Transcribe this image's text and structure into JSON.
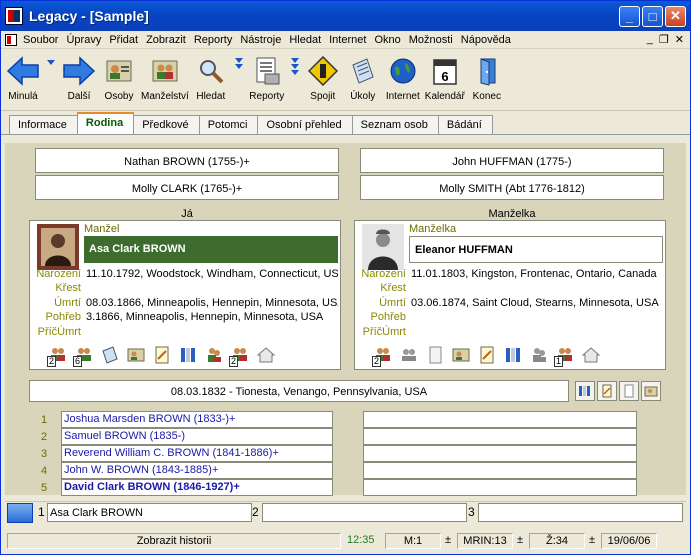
{
  "window": {
    "title": "Legacy - [Sample]",
    "min": "_",
    "max": "□",
    "close": "✕"
  },
  "menu": [
    "Soubor",
    "Úpravy",
    "Přidat",
    "Zobrazit",
    "Reporty",
    "Nástroje",
    "Hledat",
    "Internet",
    "Okno",
    "Možnosti",
    "Nápověda"
  ],
  "mdi": {
    "min": "_",
    "restore": "❐",
    "close": "✕"
  },
  "toolbar": {
    "back": "Minulá",
    "next": "Další",
    "people": "Osoby",
    "marriages": "Manželství",
    "search": "Hledat",
    "reports": "Reporty",
    "link": "Spojit",
    "tasks": "Úkoly",
    "internet": "Internet",
    "calendar": "Kalendář",
    "exit": "Konec",
    "calendar_day": "6"
  },
  "tabs": [
    "Informace",
    "Rodina",
    "Předkové",
    "Potomci",
    "Osobní přehled",
    "Seznam osob",
    "Bádání"
  ],
  "active_tab": "Rodina",
  "parents_left": {
    "father": "Nathan BROWN (1755-)+",
    "mother": "Molly CLARK (1765-)+"
  },
  "parents_right": {
    "father": "John HUFFMAN (1775-)",
    "mother": "Molly SMITH (Abt 1776-1812)"
  },
  "labels": {
    "me": "Já",
    "wife_header": "Manželka"
  },
  "husband": {
    "role": "Manžel",
    "name": "Asa Clark BROWN",
    "events": {
      "labels": [
        "Narození",
        "Křest",
        "Úmrtí",
        "Pohřeb",
        "PříčÚmrt"
      ],
      "values": [
        "11.10.1792, Woodstock, Windham, Connecticut, USA",
        "",
        "08.03.1866, Minneapolis, Hennepin, Minnesota, USA",
        "3.1866, Minneapolis, Hennepin, Minnesota, USA",
        ""
      ]
    },
    "badges": {
      "parents": "2",
      "children": "6",
      "spouses": "2"
    }
  },
  "wife": {
    "role": "Manželka",
    "name": "Eleanor HUFFMAN",
    "events": {
      "labels": [
        "Narození",
        "Křest",
        "Úmrtí",
        "Pohřeb",
        "PříčÚmrt"
      ],
      "values": [
        "11.01.1803, Kingston, Frontenac, Ontario, Canada",
        "",
        "03.06.1874, Saint Cloud, Stearns, Minnesota, USA",
        "",
        ""
      ]
    },
    "badges": {
      "parents": "2",
      "spouses": "1"
    }
  },
  "marriage": "08.03.1832 - Tionesta, Venango, Pennsylvania, USA",
  "children": [
    {
      "num": "1",
      "name": "Joshua Marsden BROWN (1833-)+"
    },
    {
      "num": "2",
      "name": "Samuel BROWN (1835-)"
    },
    {
      "num": "3",
      "name": "Reverend William C. BROWN (1841-1886)+"
    },
    {
      "num": "4",
      "name": "John W. BROWN (1843-1885)+"
    },
    {
      "num": "5",
      "name": "David Clark BROWN (1846-1927)+"
    }
  ],
  "history": {
    "slot1_num": "1",
    "slot1": "Asa Clark BROWN",
    "slot2_num": "2",
    "slot3_num": "3"
  },
  "status": {
    "history_btn": "Zobrazit historii",
    "time": "12:35",
    "m": "M:1",
    "mrin": "MRIN:13",
    "z": "Ž:34",
    "date": "19/06/06",
    "pm": "±"
  },
  "colors": {
    "namebar": "#3e6b2e",
    "child_text": "#1a1aa8",
    "label": "#8a8a00",
    "panel": "#d9d5bb"
  }
}
